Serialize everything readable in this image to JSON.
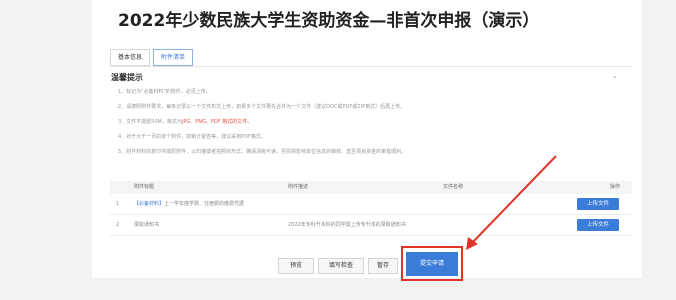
{
  "page_title": "2022年少数民族大学生资助资金—非首次申报（演示）",
  "tabs": [
    {
      "label": "基本信息"
    },
    {
      "label": "附件清单"
    }
  ],
  "tips": {
    "title": "温馨提示",
    "items": [
      "1、标记为\"必备材料\"的附件，必须上传。",
      "2、请按照附件要求，每条记录以一个文件形式上传，如果多个文件要先合并为一个文件（建议DOC或PDF或ZIP格式）后再上传。",
      "3、文件不能超50M，格式为",
      "4、对于大于一页的单个附件，如审计报告等，建议采用PDF格式。",
      "5、附件材料的复印件或原附件，以扫描或者拍照的形式，确保清晰可读，否则将影响单位信息的审核、直至项目资金的审批顺利。"
    ],
    "formats_red": "JPG、PNG、PDF 格式的文件。"
  },
  "table": {
    "headers": {
      "name": "附件标题",
      "desc": "附件描述",
      "file": "文件名称",
      "op": "操作"
    },
    "rows": [
      {
        "no": "1",
        "tag": "【必备材料】",
        "name": "上一学年度学费、住宿费的缴费凭据",
        "desc": "",
        "file": "",
        "upload": "上传文件"
      },
      {
        "no": "2",
        "tag": "",
        "name": "录取通知书",
        "desc": "2022年专科升本科的同学需上传专升本的录取通知书",
        "file": "",
        "upload": "上传文件"
      }
    ]
  },
  "footer": {
    "preview": "预览",
    "check": "填写检查",
    "save": "暂存",
    "submit": "提交申请"
  },
  "colors": {
    "accent": "#3a7cd8",
    "highlight": "#e0332a"
  }
}
